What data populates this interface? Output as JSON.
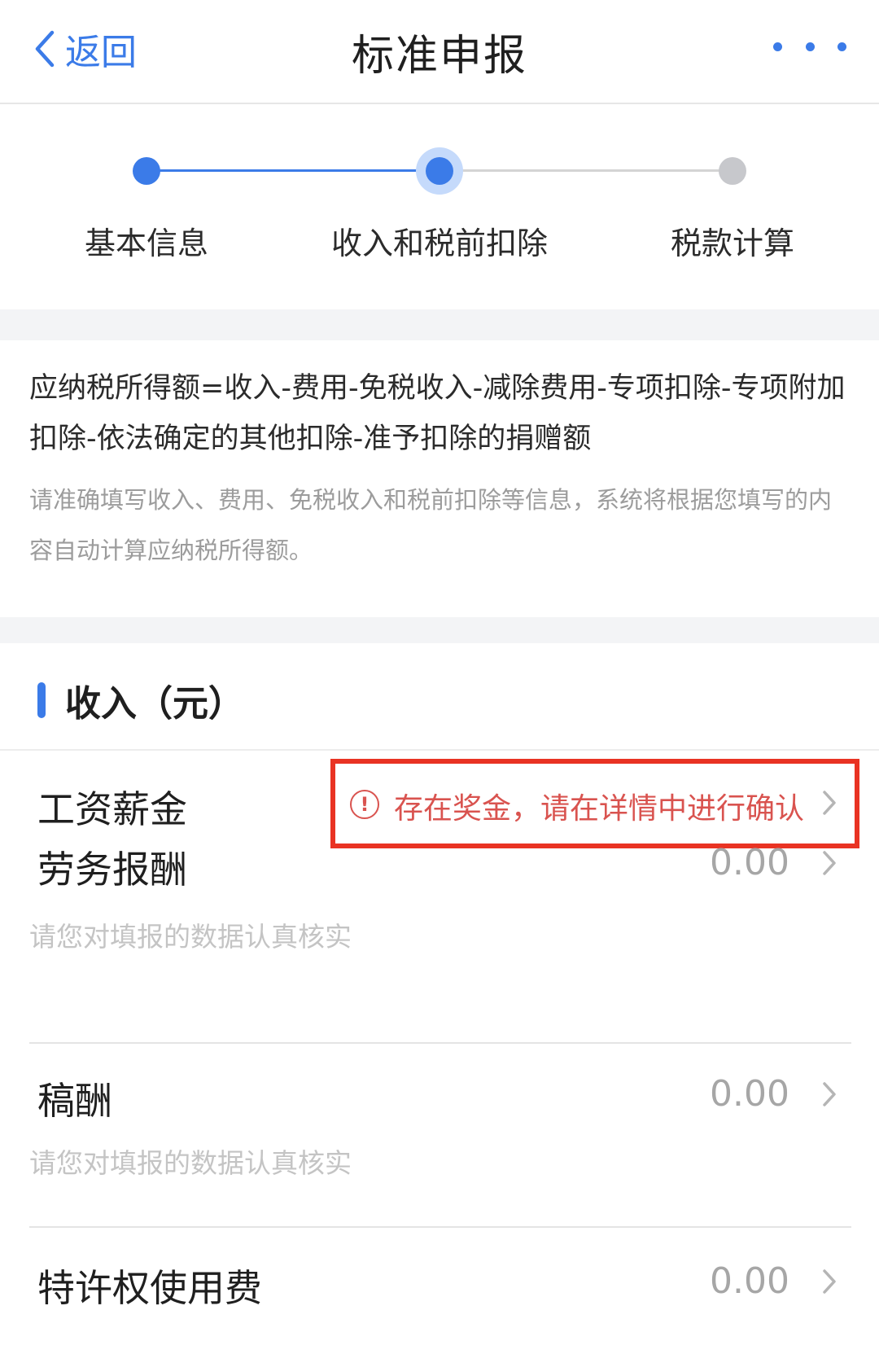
{
  "nav": {
    "back_label": "返回",
    "title": "标准申报",
    "more_icon": "more-dots-icon",
    "accent_color": "#3b7be8"
  },
  "steps": [
    {
      "label": "基本信息",
      "state": "done"
    },
    {
      "label": "收入和税前扣除",
      "state": "current"
    },
    {
      "label": "税款计算",
      "state": "pending"
    }
  ],
  "formula": {
    "text": "应纳税所得额=收入-费用-免税收入-减除费用-专项扣除-专项附加扣除-依法确定的其他扣除-准予扣除的捐赠额",
    "hint": "请准确填写收入、费用、免税收入和税前扣除等信息，系统将根据您填写的内容自动计算应纳税所得额。"
  },
  "income": {
    "title": "收入（元）",
    "rows": [
      {
        "label": "工资薪金",
        "alert": "存在奖金，请在详情中进行确认",
        "alert_color": "#d9534f"
      },
      {
        "label": "劳务报酬",
        "value": "0.00",
        "hint": "请您对填报的数据认真核实"
      },
      {
        "label": "稿酬",
        "value": "0.00",
        "hint": "请您对填报的数据认真核实"
      },
      {
        "label": "特许权使用费",
        "value": "0.00"
      }
    ]
  }
}
